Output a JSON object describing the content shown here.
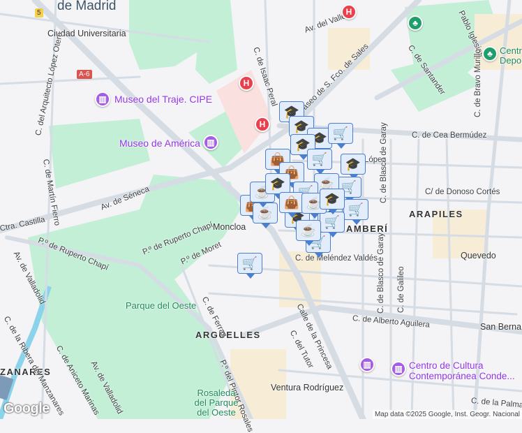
{
  "map": {
    "areas": {
      "de_madrid": "de Madrid",
      "arguelles": "ARGÜELLES",
      "arapiles": "ARAPILES",
      "chamberi": "AMBERÍ",
      "manzanares": "ZANARES"
    },
    "metro": [
      "Ciudad Universitaria",
      "Moncloa",
      "Quevedo",
      "San Berna",
      "Ventura Rodríguez"
    ],
    "streets": [
      "C. del Arquitecto López Otero",
      "C. de Martín Fierro",
      "Av. de Séneca",
      "Ctra. Castilla",
      "P.º de Ruperto Chapí",
      "P.º de Ruperto Chapí",
      "P.º de Moret",
      "Av. de Valladolid",
      "C. de la Ribera del Manzanares",
      "C. de Aniceto Marinas",
      "Av. de Valladolid",
      "C. de Ferraz",
      "P.º del Pintor Rosales",
      "C. de Isaac Peral",
      "Paseo de S. Fco. de Sales",
      "Av. del Valle",
      "C. de Santander",
      "Pablo Iglesias",
      "C. de Cea Bermúdez",
      "C. de Bravo Murillo",
      "López",
      "C. de Blasco de Garay",
      "C/ de Donoso Cortés",
      "C. de Meléndez Valdés",
      "C. de Blasco de Garay",
      "C. de Galileo",
      "C. de Alberto Aguilera",
      "Calle de la Princesa",
      "C. del Tutor",
      "C. de la Palma"
    ],
    "parks": [
      "Parque del Oeste",
      "Rosaleda del Parque del Oeste"
    ],
    "pois": [
      "Museo del Traje. CIPE",
      "Museo de América",
      "Centro de Cultura Contemporánea Conde...",
      "Centro Depo"
    ],
    "shields": {
      "a6": "A-6",
      "m5": "5"
    },
    "hospital": "H",
    "attribution": "Map data ©2025 Google, Inst. Geogr. Nacional",
    "google_logo": "Google",
    "colors": {
      "park": "#c3efd7",
      "road": "#d5dce4",
      "marker_bg": "#e3ecfb",
      "marker_border": "#4a7fd0",
      "hospital": "#e8414d",
      "poi": "#9334e6"
    }
  },
  "markers": [
    "education",
    "education",
    "education",
    "education",
    "education",
    "education",
    "education",
    "shopping-cart",
    "shopping-cart",
    "shopping-cart",
    "shopping-cart",
    "shopping-cart",
    "shopping-cart",
    "shopping-cart",
    "shopping-bag",
    "shopping-bag",
    "shopping-bag",
    "coffee",
    "coffee",
    "coffee",
    "coffee",
    "education",
    "shopping-cart",
    "shopping-bag",
    "coffee",
    "education"
  ]
}
